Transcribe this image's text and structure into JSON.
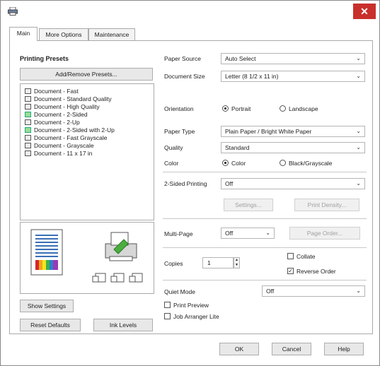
{
  "window": {
    "close_glyph": "✕",
    "app_icon": "printer-icon",
    "accent_close": "#c9302c"
  },
  "tabs": [
    {
      "label": "Main"
    },
    {
      "label": "More Options"
    },
    {
      "label": "Maintenance"
    }
  ],
  "presets": {
    "heading": "Printing Presets",
    "add_remove_label": "Add/Remove Presets...",
    "items": [
      "Document - Fast",
      "Document - Standard Quality",
      "Document - High Quality",
      "Document - 2-Sided",
      "Document - 2-Up",
      "Document - 2-Sided with 2-Up",
      "Document - Fast Grayscale",
      "Document - Grayscale",
      "Document - 11 x 17 in"
    ]
  },
  "left_buttons": {
    "show_settings": "Show Settings",
    "reset_defaults": "Reset Defaults",
    "ink_levels": "Ink Levels"
  },
  "settings": {
    "paper_source_label": "Paper Source",
    "paper_source_value": "Auto Select",
    "document_size_label": "Document Size",
    "document_size_value": "Letter (8 1/2 x 11 in)",
    "orientation_label": "Orientation",
    "orientation_portrait": "Portrait",
    "orientation_landscape": "Landscape",
    "paper_type_label": "Paper Type",
    "paper_type_value": "Plain Paper / Bright White Paper",
    "quality_label": "Quality",
    "quality_value": "Standard",
    "color_label": "Color",
    "color_color": "Color",
    "color_bw": "Black/Grayscale",
    "two_sided_label": "2-Sided Printing",
    "two_sided_value": "Off",
    "settings_btn": "Settings...",
    "print_density_btn": "Print Density...",
    "multipage_label": "Multi-Page",
    "multipage_value": "Off",
    "page_order_btn": "Page Order...",
    "copies_label": "Copies",
    "copies_value": "1",
    "collate_label": "Collate",
    "reverse_order_label": "Reverse Order",
    "quiet_mode_label": "Quiet Mode",
    "quiet_mode_value": "Off",
    "print_preview_label": "Print Preview",
    "job_arranger_label": "Job Arranger Lite"
  },
  "footer": {
    "ok": "OK",
    "cancel": "Cancel",
    "help": "Help"
  }
}
